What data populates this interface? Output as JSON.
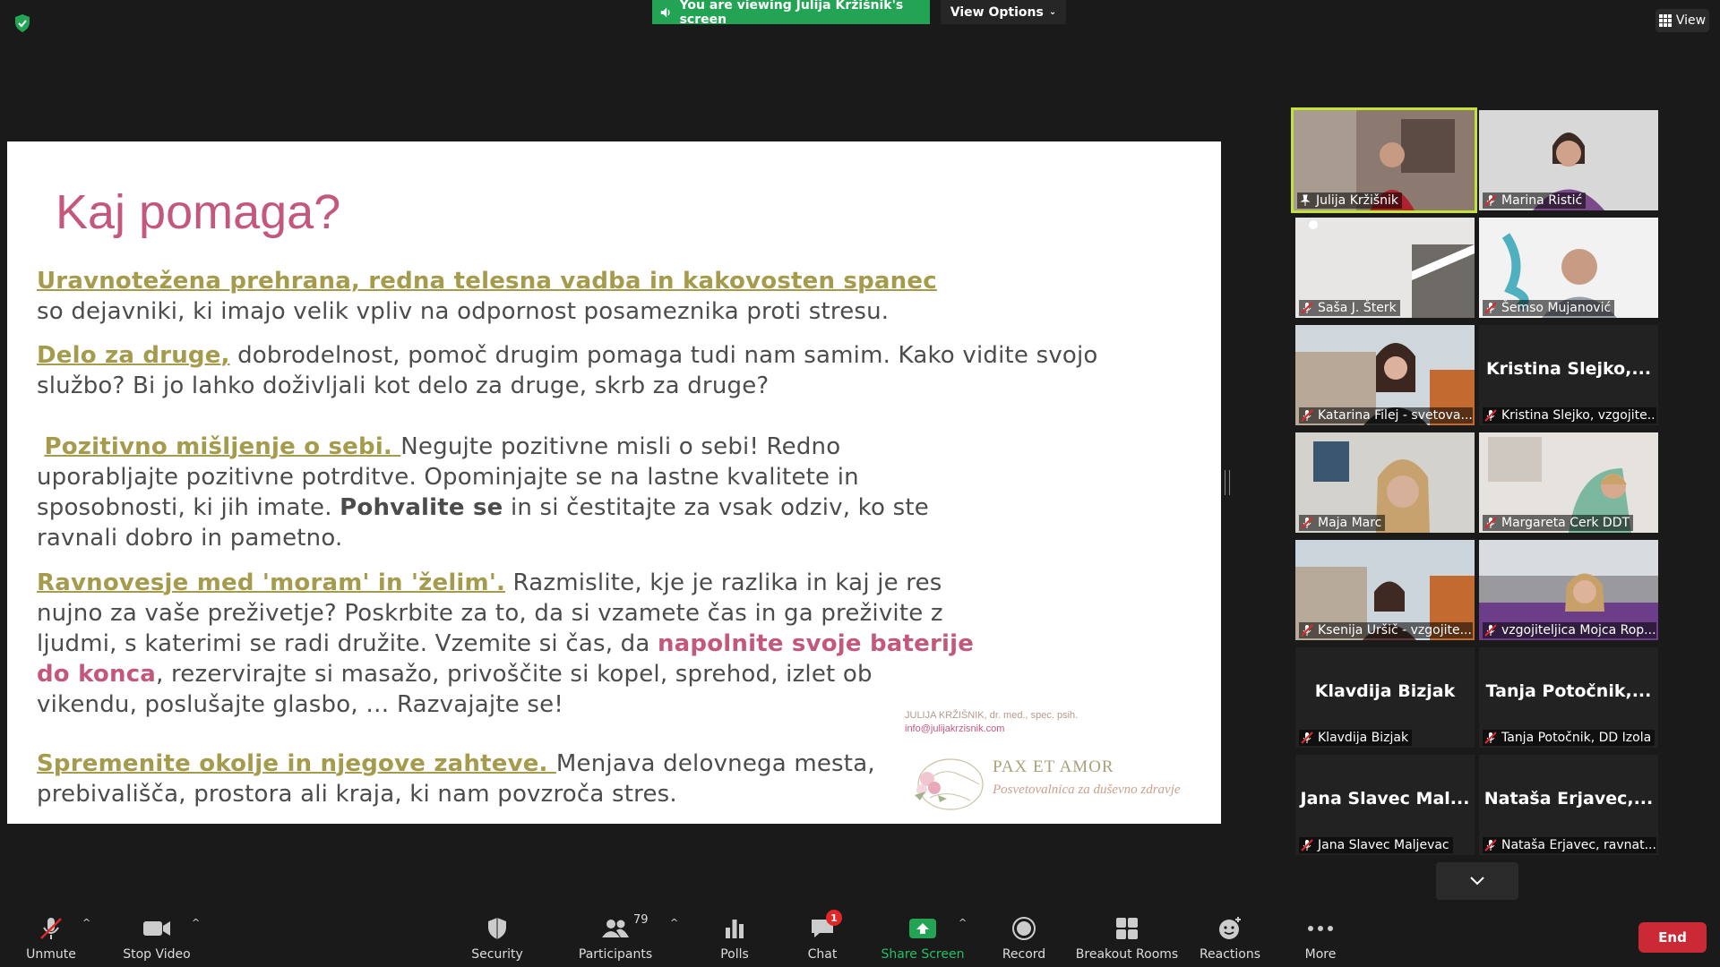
{
  "banner": {
    "text": "You are viewing Julija Kržišnik's screen"
  },
  "view_options": {
    "label": "View Options"
  },
  "view_button": {
    "label": "View"
  },
  "slide": {
    "title": "Kaj pomaga?",
    "p1_hl": "Uravnotežena prehrana, redna telesna vadba in kakovosten spanec",
    "p1_rest": "so dejavniki, ki imajo velik vpliv na odpornost posameznika proti stresu.",
    "p2_hl": "Delo za druge,",
    "p2_rest_l1": " dobrodelnost, pomoč drugim pomaga tudi nam samim. Kako vidite svojo",
    "p2_l2": "službo? Bi jo lahko doživljali kot delo za druge, skrb za druge?",
    "p3_hl": "Pozitivno mišljenje o sebi. ",
    "p3_rest_l1": "Negujte pozitivne misli o sebi! Redno",
    "p3_l2": "uporabljajte pozitivne potrditve. Opominjajte se na lastne kvalitete in",
    "p3_l3_a": "sposobnosti, ki jih imate. ",
    "p3_l3_bold": "Pohvalite se",
    "p3_l3_b": " in si čestitajte za vsak odziv, ko ste",
    "p3_l4": "ravnali dobro in pametno.",
    "p4_hl": "Ravnovesje med 'moram' in 'želim'.",
    "p4_rest_l1": " Razmislite, kje je razlika in kaj je res",
    "p4_l2": "nujno za vaše preživetje? Poskrbite za to, da si vzamete čas in ga preživite z",
    "p4_l3_a": "ljudmi, s katerimi se radi družite. Vzemite si čas, da ",
    "p4_l3_pink": "napolnite svoje baterije",
    "p4_l4_pink": "do konca",
    "p4_l4_b": ", rezervirajte si masažo, privoščite si kopel, sprehod, izlet ob",
    "p4_l5": "vikendu, poslušajte glasbo, … Razvajajte se!",
    "p5_hl": "Spremenite okolje in njegove zahteve. ",
    "p5_rest_l1": "Menjava delovnega mesta,",
    "p5_l2": "prebivališča, prostora ali kraja, ki nam povzroča stres.",
    "sig_name": "JULIJA KRŽIŠNIK, dr. med., spec. psih.",
    "sig_email": "info@julijakrzisnik.com",
    "brand": "PAX ET AMOR",
    "tagline": "Posvetovalnica za duševno zdravje"
  },
  "participants": [
    {
      "name": "Julija Kržišnik",
      "video": true,
      "active": true,
      "pinned": true
    },
    {
      "name": "Marina Ristić",
      "video": true
    },
    {
      "name": "Saša J. Šterk",
      "video": true
    },
    {
      "name": "Šemso Mujanović",
      "video": true
    },
    {
      "name": "Katarina Filej - svetova...",
      "video": true
    },
    {
      "name": "Kristina Slejko, vzgojite...",
      "video": false,
      "display": "Kristina  Slejko,..."
    },
    {
      "name": "Maja Marc",
      "video": true
    },
    {
      "name": "Margareta Cerk DDT",
      "video": true
    },
    {
      "name": "Ksenija Uršič - vzgojite...",
      "video": true
    },
    {
      "name": "vzgojiteljica Mojca Rop...",
      "video": true
    },
    {
      "name": "Klavdija Bizjak",
      "video": false,
      "display": "Klavdija Bizjak"
    },
    {
      "name": "Tanja Potočnik, DD Izola",
      "video": false,
      "display": "Tanja  Potočnik,..."
    },
    {
      "name": "Jana Slavec Maljevac",
      "video": false,
      "display": "Jana  Slavec  Mal..."
    },
    {
      "name": "Nataša Erjavec, ravnat...",
      "video": false,
      "display": "Nataša  Erjavec,..."
    }
  ],
  "toolbar": {
    "unmute": "Unmute",
    "stop_video": "Stop Video",
    "security": "Security",
    "participants": "Participants",
    "participants_count": "79",
    "polls": "Polls",
    "chat": "Chat",
    "chat_badge": "1",
    "share_screen": "Share Screen",
    "record": "Record",
    "breakout_rooms": "Breakout Rooms",
    "reactions": "Reactions",
    "more": "More",
    "end": "End"
  },
  "colors": {
    "accent_green": "#23a454",
    "active_border": "#c5e23a",
    "title_pink": "#c3587a",
    "highlight_olive": "#a59b4c",
    "end_red": "#cc2936"
  }
}
